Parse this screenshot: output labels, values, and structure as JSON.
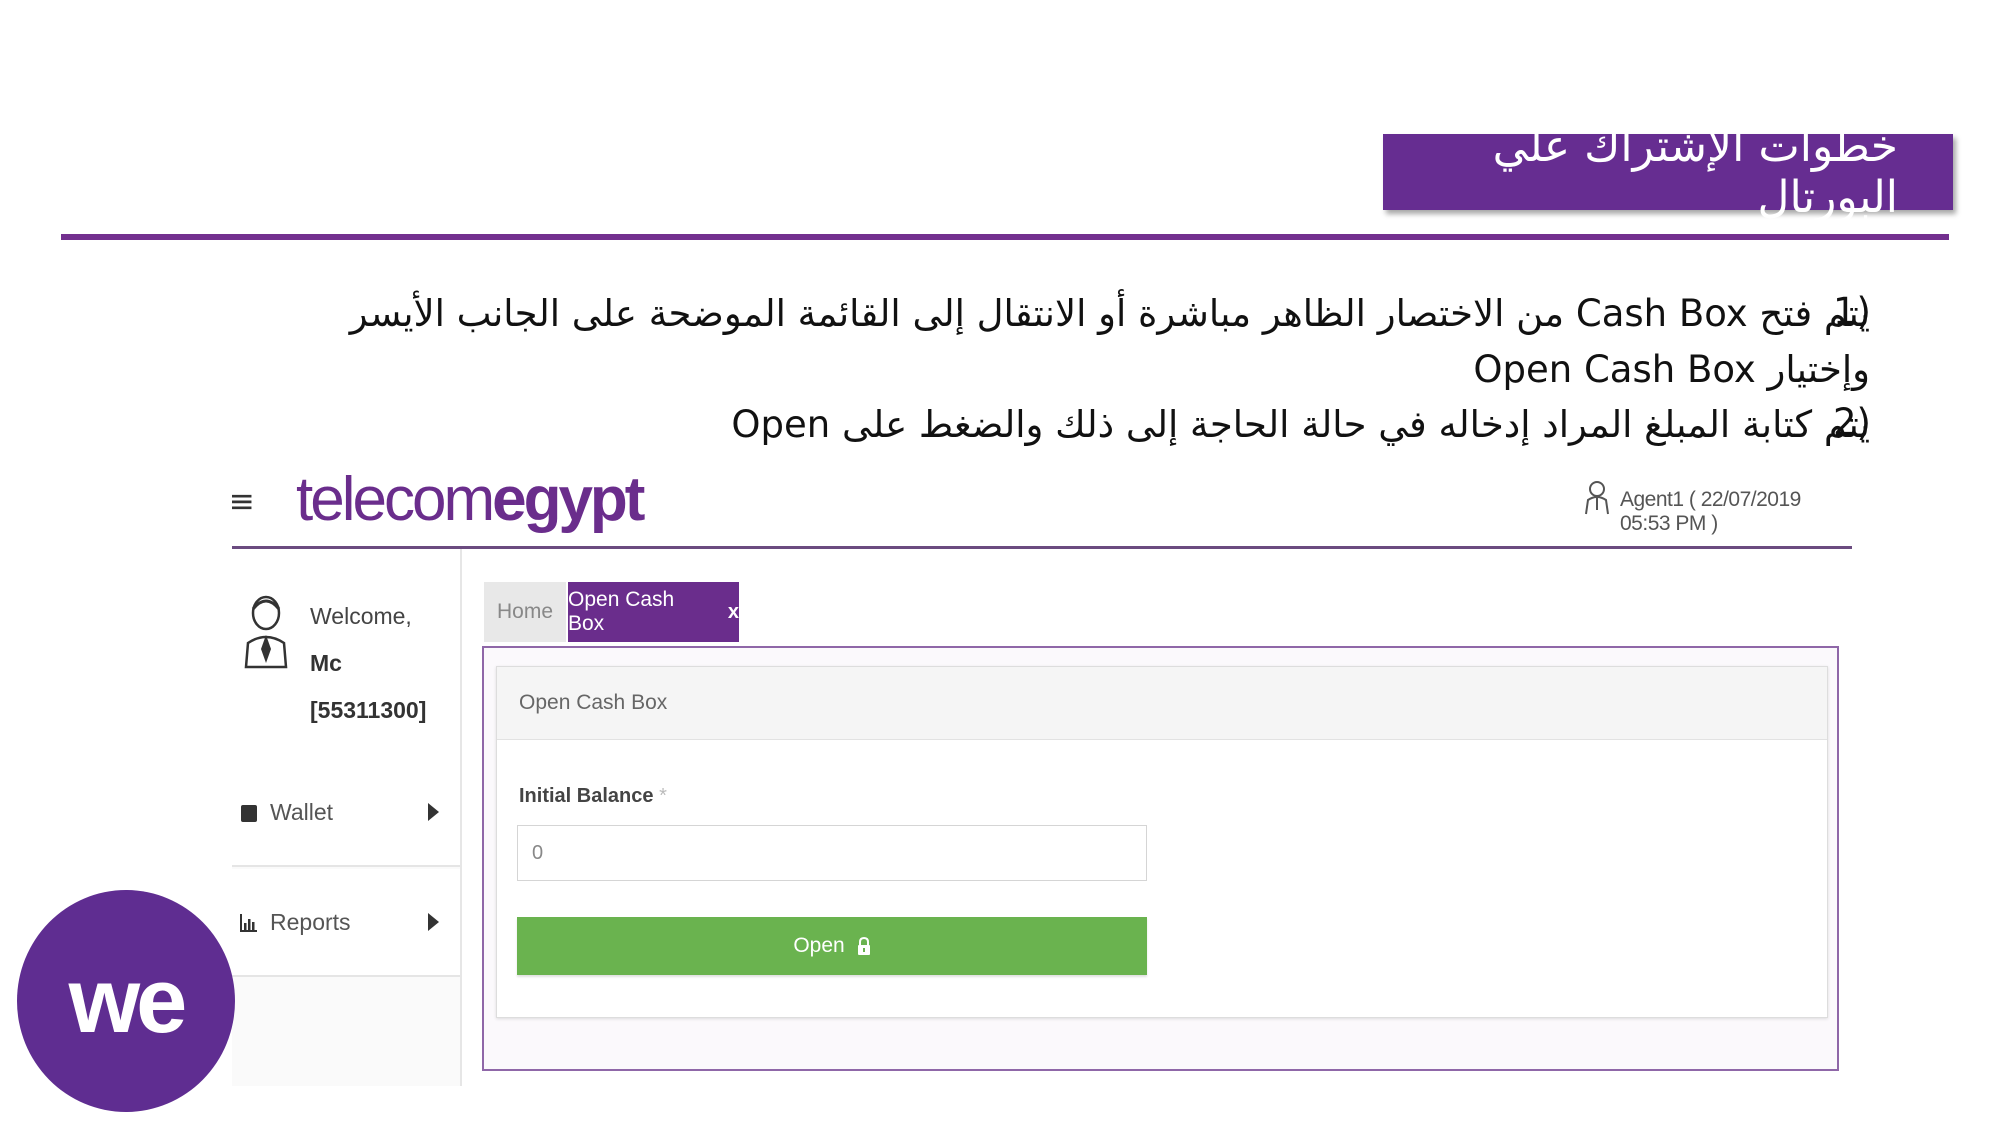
{
  "slide": {
    "title": "خطوات الإشتراك علي البورتال",
    "steps": [
      {
        "number": "1)",
        "line1": "يتم فتح Cash Box من الاختصار الظاهر مباشرة أو الانتقال إلى القائمة الموضحة على الجانب الأيسر",
        "line2": "وإختيار Open Cash Box"
      },
      {
        "number": "2)",
        "line1": "يتم كتابة المبلغ المراد إدخاله في حالة الحاجة إلى ذلك والضغط على Open"
      }
    ],
    "brand_logo": "we",
    "accent_color": "#662d91"
  },
  "app": {
    "logo_light": "telecom",
    "logo_bold": "egypt",
    "agent_info": "Agent1 ( 22/07/2019 05:53 PM )",
    "sidebar": {
      "welcome": "Welcome,",
      "name_partial": "Mc",
      "account_id": "[55311300]",
      "items": [
        {
          "label": "Wallet",
          "icon": "wallet-icon"
        },
        {
          "label": "Reports",
          "icon": "chart-icon"
        }
      ]
    },
    "tabs": [
      {
        "label": "Home",
        "active": false
      },
      {
        "label": "Open Cash Box",
        "active": true,
        "close": "x"
      }
    ],
    "panel": {
      "title": "Open Cash Box",
      "field_label": "Initial Balance",
      "required_mark": "*",
      "field_value": "0",
      "button_label": "Open",
      "button_color": "#6ab34f"
    }
  }
}
